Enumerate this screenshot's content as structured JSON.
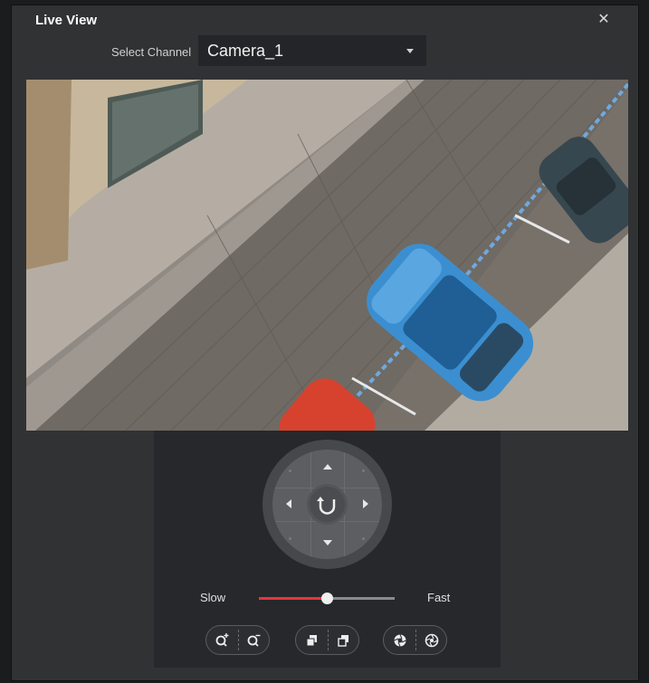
{
  "window": {
    "title": "Live View",
    "close_icon": "close-icon"
  },
  "channel": {
    "label": "Select Channel",
    "value": "Camera_1"
  },
  "video": {
    "description_icon": "camera-feed"
  },
  "ptz": {
    "speed": {
      "slow_label": "Slow",
      "fast_label": "Fast",
      "level": 0.5
    },
    "buttons": [
      "zoom-in-icon",
      "zoom-out-icon",
      "focus-near-icon",
      "focus-far-icon",
      "iris-open-icon",
      "iris-close-icon"
    ]
  },
  "colors": {
    "accent": "#e8353b",
    "background": "#303234",
    "panel": "#26282b"
  }
}
